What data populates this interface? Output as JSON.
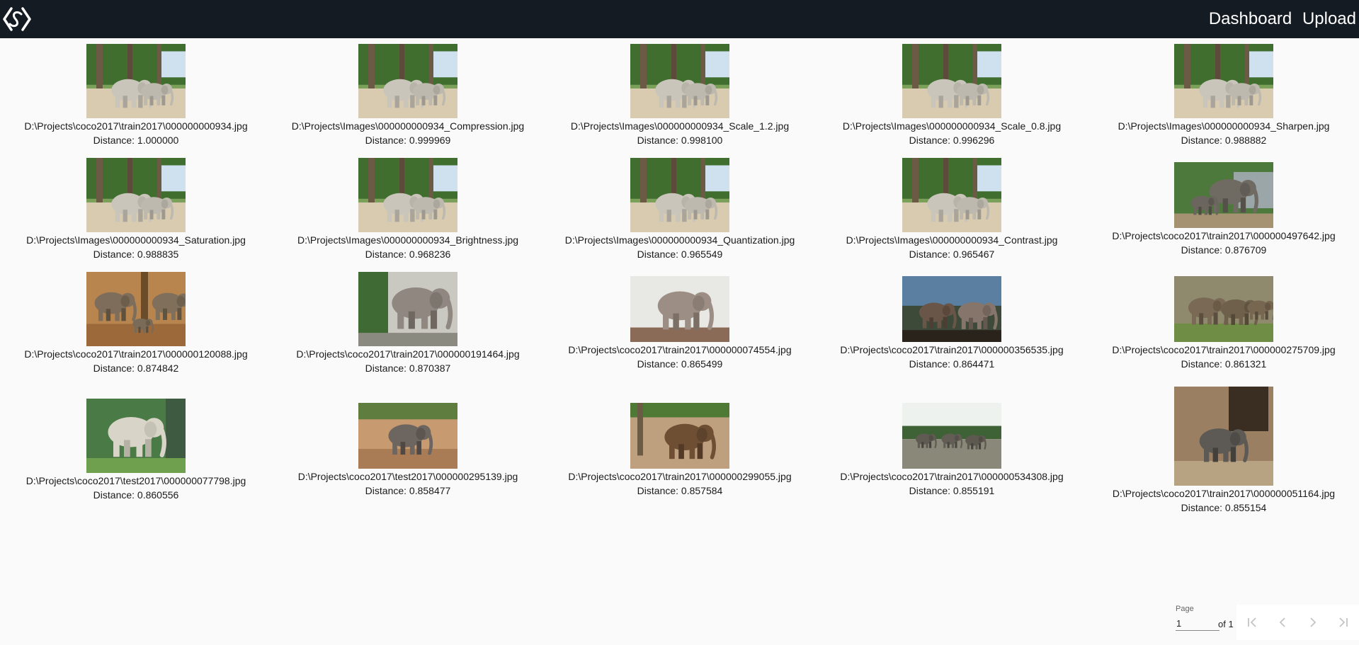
{
  "header": {
    "nav": [
      "Dashboard",
      "Upload"
    ]
  },
  "results": [
    {
      "path": "D:\\Projects\\coco2017\\train2017\\000000000934.jpg",
      "distance": "Distance: 1.000000",
      "image": "elephants-934"
    },
    {
      "path": "D:\\Projects\\Images\\000000000934_Compression.jpg",
      "distance": "Distance: 0.999969",
      "image": "elephants-934"
    },
    {
      "path": "D:\\Projects\\Images\\000000000934_Scale_1.2.jpg",
      "distance": "Distance: 0.998100",
      "image": "elephants-934"
    },
    {
      "path": "D:\\Projects\\Images\\000000000934_Scale_0.8.jpg",
      "distance": "Distance: 0.996296",
      "image": "elephants-934"
    },
    {
      "path": "D:\\Projects\\Images\\000000000934_Sharpen.jpg",
      "distance": "Distance: 0.988882",
      "image": "elephants-934"
    },
    {
      "path": "D:\\Projects\\Images\\000000000934_Saturation.jpg",
      "distance": "Distance: 0.988835",
      "image": "elephants-934"
    },
    {
      "path": "D:\\Projects\\Images\\000000000934_Brightness.jpg",
      "distance": "Distance: 0.968236",
      "image": "elephants-934"
    },
    {
      "path": "D:\\Projects\\Images\\000000000934_Quantization.jpg",
      "distance": "Distance: 0.965549",
      "image": "elephants-934"
    },
    {
      "path": "D:\\Projects\\Images\\000000000934_Contrast.jpg",
      "distance": "Distance: 0.965467",
      "image": "elephants-934"
    },
    {
      "path": "D:\\Projects\\coco2017\\train2017\\000000497642.jpg",
      "distance": "Distance: 0.876709",
      "image": "elephants-497642"
    },
    {
      "path": "D:\\Projects\\coco2017\\train2017\\000000120088.jpg",
      "distance": "Distance: 0.874842",
      "image": "elephants-120088"
    },
    {
      "path": "D:\\Projects\\coco2017\\train2017\\000000191464.jpg",
      "distance": "Distance: 0.870387",
      "image": "elephant-191464"
    },
    {
      "path": "D:\\Projects\\coco2017\\train2017\\000000074554.jpg",
      "distance": "Distance: 0.865499",
      "image": "elephant-74554"
    },
    {
      "path": "D:\\Projects\\coco2017\\train2017\\000000356535.jpg",
      "distance": "Distance: 0.864471",
      "image": "elephants-356535"
    },
    {
      "path": "D:\\Projects\\coco2017\\train2017\\000000275709.jpg",
      "distance": "Distance: 0.861321",
      "image": "elephants-275709"
    },
    {
      "path": "D:\\Projects\\coco2017\\test2017\\000000077798.jpg",
      "distance": "Distance: 0.860556",
      "image": "elephant-77798"
    },
    {
      "path": "D:\\Projects\\coco2017\\test2017\\000000295139.jpg",
      "distance": "Distance: 0.858477",
      "image": "elephant-295139"
    },
    {
      "path": "D:\\Projects\\coco2017\\train2017\\000000299055.jpg",
      "distance": "Distance: 0.857584",
      "image": "elephant-299055"
    },
    {
      "path": "D:\\Projects\\coco2017\\train2017\\000000534308.jpg",
      "distance": "Distance: 0.855191",
      "image": "elephants-534308"
    },
    {
      "path": "D:\\Projects\\coco2017\\train2017\\000000051164.jpg",
      "distance": "Distance: 0.855154",
      "image": "elephant-51164"
    }
  ],
  "paginator": {
    "label": "Page",
    "current": "1",
    "of_text": "of 1",
    "icons": [
      "first-page-icon",
      "prev-page-icon",
      "next-page-icon",
      "last-page-icon"
    ]
  },
  "colors": {
    "topbar": "#141b22",
    "background": "#fafafa",
    "paginator_icon": "#c4c4c4"
  }
}
